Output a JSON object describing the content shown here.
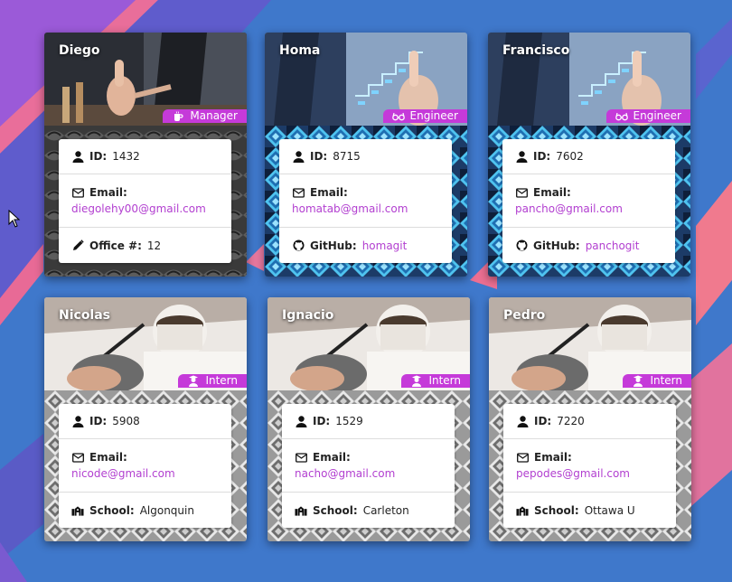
{
  "cards": [
    {
      "name": "Diego",
      "role": "Manager",
      "role_icon": "mug-icon",
      "id_label": "ID:",
      "id": "1432",
      "email_label": "Email:",
      "email": "diegolehy00@gmail.com",
      "extra_label": "Office #:",
      "extra_value": "12",
      "extra_icon": "pencil-icon"
    },
    {
      "name": "Homa",
      "role": "Engineer",
      "role_icon": "glasses-icon",
      "id_label": "ID:",
      "id": "8715",
      "email_label": "Email:",
      "email": "homatab@gmail.com",
      "extra_label": "GitHub:",
      "extra_value": "homagit",
      "extra_icon": "github-icon"
    },
    {
      "name": "Francisco",
      "role": "Engineer",
      "role_icon": "glasses-icon",
      "id_label": "ID:",
      "id": "7602",
      "email_label": "Email:",
      "email": "pancho@gmail.com",
      "extra_label": "GitHub:",
      "extra_value": "panchogit",
      "extra_icon": "github-icon"
    },
    {
      "name": "Nicolas",
      "role": "Intern",
      "role_icon": "graduate-icon",
      "id_label": "ID:",
      "id": "5908",
      "email_label": "Email:",
      "email": "nicode@gmail.com",
      "extra_label": "School:",
      "extra_value": "Algonquin",
      "extra_icon": "school-icon"
    },
    {
      "name": "Ignacio",
      "role": "Intern",
      "role_icon": "graduate-icon",
      "id_label": "ID:",
      "id": "1529",
      "email_label": "Email:",
      "email": "nacho@gmail.com",
      "extra_label": "School:",
      "extra_value": "Carleton",
      "extra_icon": "school-icon"
    },
    {
      "name": "Pedro",
      "role": "Intern",
      "role_icon": "graduate-icon",
      "id_label": "ID:",
      "id": "7220",
      "email_label": "Email:",
      "email": "pepodes@gmail.com",
      "extra_label": "School:",
      "extra_value": "Ottawa U",
      "extra_icon": "school-icon"
    }
  ],
  "colors": {
    "accent": "#c53ad9",
    "link": "#b23fd0",
    "background": "#3e74c8"
  }
}
